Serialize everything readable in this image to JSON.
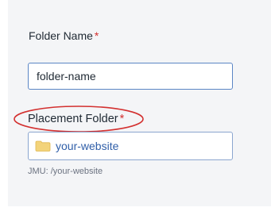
{
  "form": {
    "folder_name": {
      "label": "Folder Name",
      "required_marker": "*",
      "value": "folder-name"
    },
    "placement_folder": {
      "label": "Placement Folder",
      "required_marker": "*",
      "value": "your-website",
      "icon": "folder-icon",
      "hint": "JMU: /your-website"
    }
  },
  "colors": {
    "required": "#d3302f",
    "annotation": "#d3302f",
    "link_blue": "#2f5ea8",
    "folder": "#f3d37a"
  }
}
